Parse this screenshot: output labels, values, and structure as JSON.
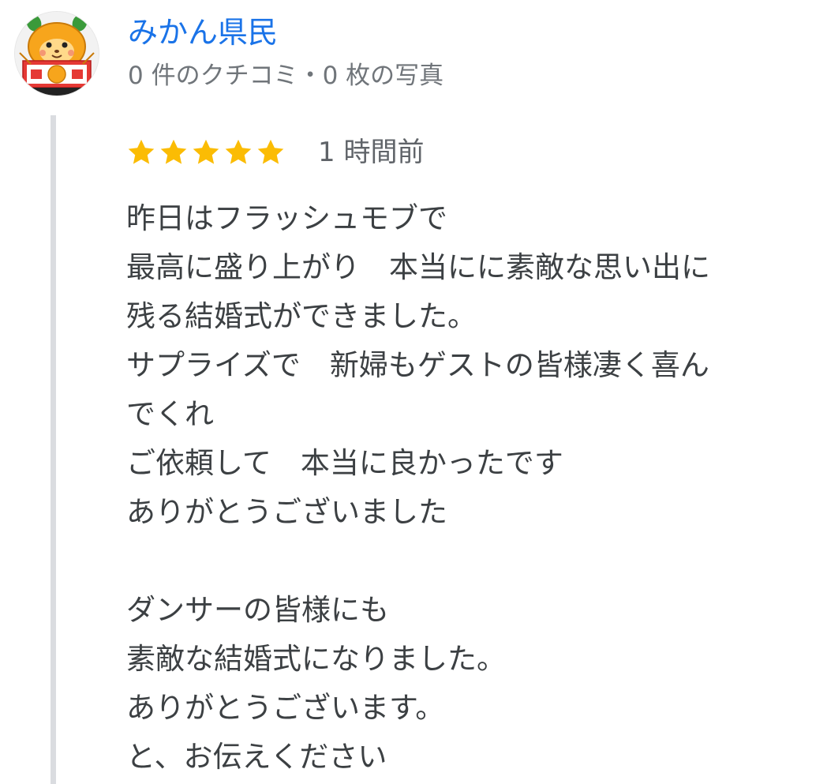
{
  "reviewer": {
    "name": "みかん県民",
    "meta": "0 件のクチコミ・0 枚の写真",
    "avatar_icon": "mikan-mascot-avatar-icon"
  },
  "rating": {
    "stars": 5,
    "max_stars": 5,
    "star_color": "#fbbc04",
    "time_ago": "1 時間前"
  },
  "review": {
    "lines": [
      "昨日はフラッシュモブで",
      "最高に盛り上がり　本当にに素敵な思い出に",
      "残る結婚式ができました。",
      "サプライズで　新婦もゲストの皆様凄く喜ん",
      "でくれ",
      "ご依頼して　本当に良かったです",
      "ありがとうございました",
      "",
      "ダンサーの皆様にも",
      "素敵な結婚式になりました。",
      "ありがとうございます。",
      "と、お伝えください"
    ]
  },
  "colors": {
    "name_link": "#1a73e8",
    "meta_text": "#70757a",
    "body_text": "#3c4043",
    "quote_bar": "#dadce0"
  }
}
